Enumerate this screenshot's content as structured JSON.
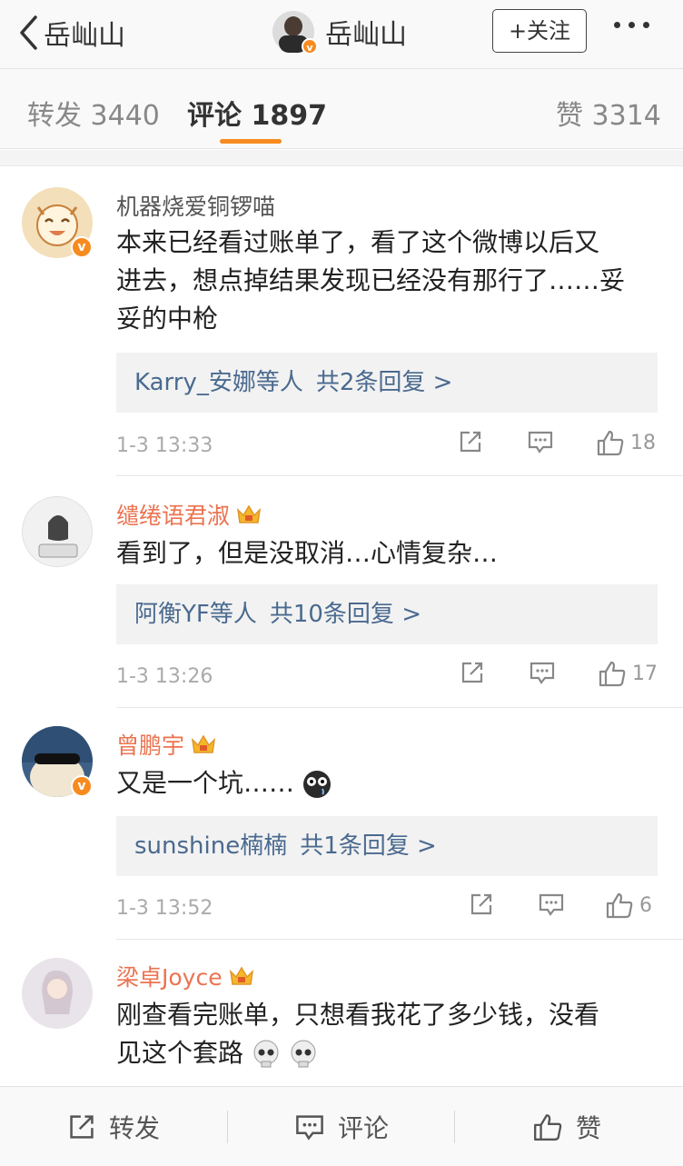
{
  "header": {
    "back_label": "岳屾山",
    "title": "岳屾山",
    "follow_label": "+关注"
  },
  "tabs": {
    "repost": "转发 3440",
    "comments": "评论 1897",
    "likes": "赞 3314"
  },
  "comments": [
    {
      "username": "机器烧爱铜锣喵",
      "text_lines": [
        "本来已经看过账单了，看了这个微博以后又",
        "进去，想点掉结果发现已经没有那行了……妥",
        "妥的中枪"
      ],
      "reply_names": "Karry_安娜等人",
      "reply_count": "共2条回复 >",
      "time": "1-3 13:33",
      "likes": "18"
    },
    {
      "username": "缱绻语君淑",
      "text_lines": [
        "看到了，但是没取消…心情复杂…"
      ],
      "reply_names": "阿衡YF等人",
      "reply_count": "共10条回复 >",
      "time": "1-3 13:26",
      "likes": "17"
    },
    {
      "username": "曾鹏宇",
      "text_lines": [
        "又是一个坑……"
      ],
      "reply_names": "sunshine楠楠",
      "reply_count": "共1条回复 >",
      "time": "1-3 13:52",
      "likes": "6"
    },
    {
      "username": "梁卓Joyce",
      "text_lines": [
        "刚查看完账单，只想看我花了多少钱，没看",
        "见这个套路"
      ]
    }
  ],
  "bottom_bar": {
    "repost": "转发",
    "comment": "评论",
    "like": "赞"
  },
  "colors": {
    "accent_orange": "#f78b1f",
    "vip_name": "#eb7350",
    "link_blue": "#4a6a8f"
  }
}
